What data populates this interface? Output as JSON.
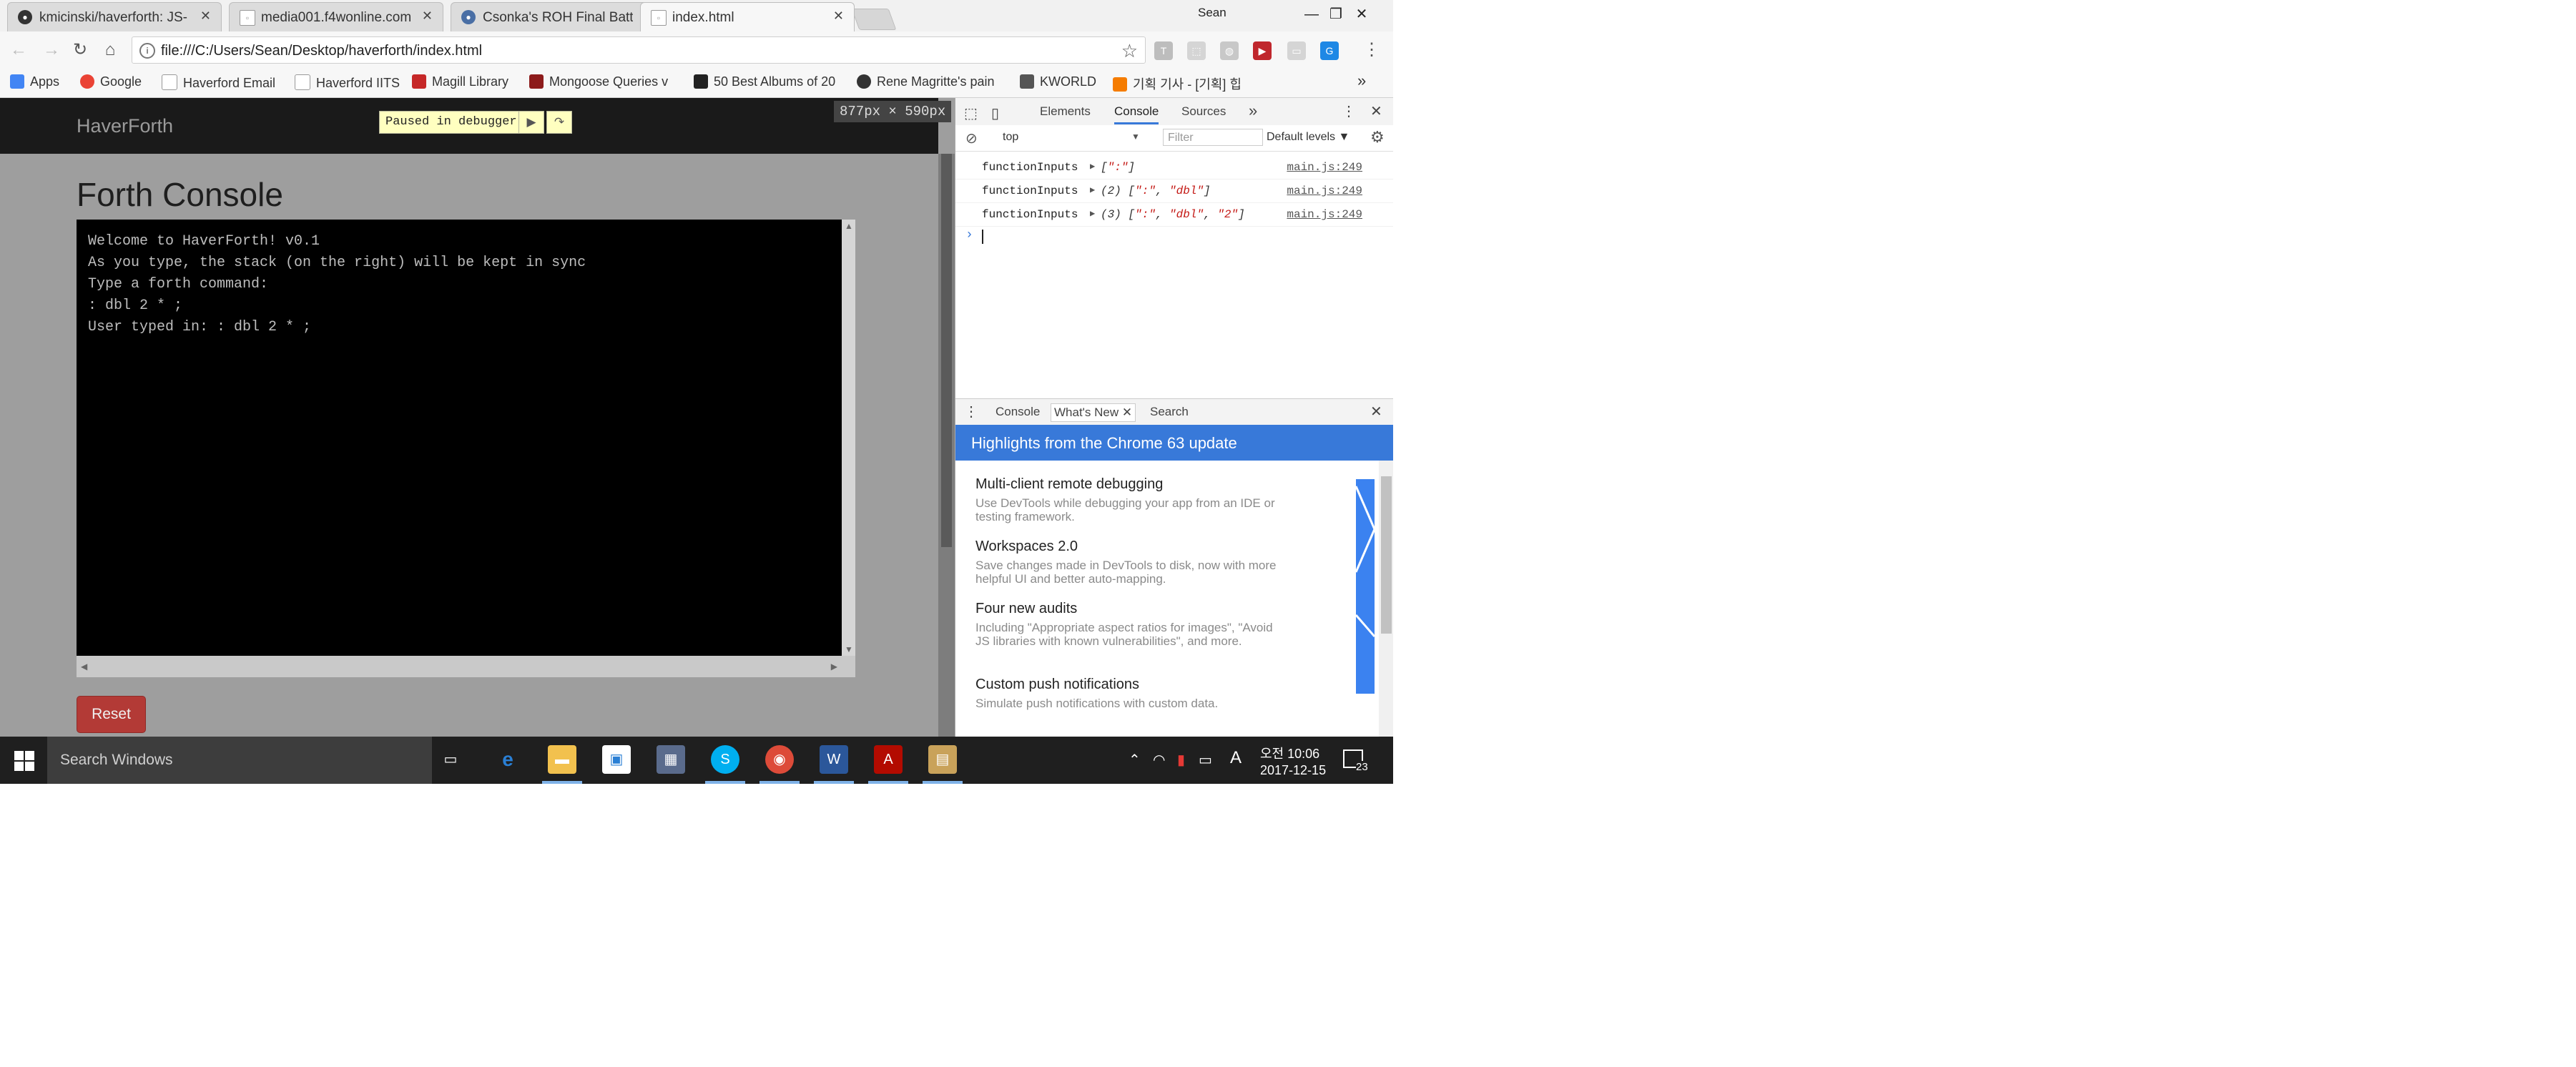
{
  "tabs": [
    {
      "title": "kmicinski/haverforth: JS-"
    },
    {
      "title": "media001.f4wonline.com"
    },
    {
      "title": "Csonka's ROH Final Battl"
    },
    {
      "title": "index.html"
    }
  ],
  "window": {
    "user": "Sean",
    "minimize": "—",
    "restore": "❐",
    "close": "✕"
  },
  "address": {
    "url": "file:///C:/Users/Sean/Desktop/haverforth/index.html"
  },
  "bookmarks": [
    {
      "label": "Apps",
      "color": "#4285f4"
    },
    {
      "label": "Google",
      "color": "#ea4335"
    },
    {
      "label": "Haverford Email",
      "color": "#bdbdbd"
    },
    {
      "label": "Haverford IITS",
      "color": "#bdbdbd"
    },
    {
      "label": "Magill Library",
      "color": "#c62828"
    },
    {
      "label": "Mongoose Queries v",
      "color": "#8d1b1b"
    },
    {
      "label": "50 Best Albums of 20",
      "color": "#222222"
    },
    {
      "label": "Rene Magritte's pain",
      "color": "#333333"
    },
    {
      "label": "KWORLD",
      "color": "#555555"
    },
    {
      "label": "기획 기사 - [기획] 힙",
      "color": "#f57c00"
    }
  ],
  "page": {
    "brand": "HaverForth",
    "paused_label": "Paused in debugger",
    "viewport_size": "877px × 590px",
    "title": "Forth Console",
    "console_lines": [
      "Welcome to HaverForth! v0.1",
      "As you type, the stack (on the right) will be kept in sync",
      "Type a forth command:",
      ": dbl 2 * ;",
      "User typed in: : dbl 2 * ;"
    ],
    "reset_label": "Reset"
  },
  "devtools": {
    "tabs": [
      "Elements",
      "Console",
      "Sources"
    ],
    "context": "top",
    "filter_placeholder": "Filter",
    "levels": "Default levels ▼",
    "logs": [
      {
        "label": "functionInputs",
        "count": "",
        "values": [
          "\":\""
        ],
        "source": "main.js:249"
      },
      {
        "label": "functionInputs",
        "count": "(2)",
        "values": [
          "\":\"",
          "\"dbl\""
        ],
        "source": "main.js:249"
      },
      {
        "label": "functionInputs",
        "count": "(3)",
        "values": [
          "\":\"",
          "\"dbl\"",
          "\"2\""
        ],
        "source": "main.js:249"
      }
    ],
    "drawer_tabs": [
      "Console",
      "What's New",
      "Search"
    ],
    "whats_new_heading": "Highlights from the Chrome 63 update",
    "whats_new_items": [
      {
        "title": "Multi-client remote debugging",
        "desc": "Use DevTools while debugging your app from an IDE or testing framework."
      },
      {
        "title": "Workspaces 2.0",
        "desc": "Save changes made in DevTools to disk, now with more helpful UI and better auto-mapping."
      },
      {
        "title": "Four new audits",
        "desc": "Including \"Appropriate aspect ratios for images\", \"Avoid JS libraries with known vulnerabilities\", and more."
      },
      {
        "title": "Custom push notifications",
        "desc": "Simulate push notifications with custom data."
      }
    ]
  },
  "taskbar": {
    "search_placeholder": "Search Windows",
    "time": "오전 10:06",
    "date": "2017-12-15",
    "ime": "A",
    "notifications": "23"
  }
}
